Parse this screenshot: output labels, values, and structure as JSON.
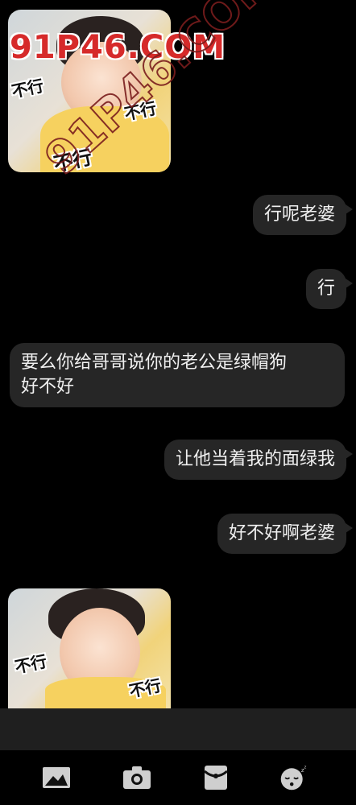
{
  "watermark": "91P46.COM",
  "messages": [
    {
      "id": "m1",
      "from": "them",
      "type": "sticker",
      "captions": [
        "不行",
        "不行",
        "不行"
      ]
    },
    {
      "id": "m2",
      "from": "me",
      "text": "行呢老婆"
    },
    {
      "id": "m3",
      "from": "me",
      "text": "行"
    },
    {
      "id": "m4",
      "from": "them",
      "text": "要么你给哥哥说你的老公是绿帽狗\n好不好"
    },
    {
      "id": "m5",
      "from": "me",
      "text": "让他当着我的面绿我"
    },
    {
      "id": "m6",
      "from": "me",
      "text": "好不好啊老婆"
    },
    {
      "id": "m7",
      "from": "them",
      "type": "sticker",
      "captions": [
        "不行",
        "不行"
      ]
    }
  ],
  "toolbar": [
    {
      "icon": "image-icon"
    },
    {
      "icon": "camera-icon"
    },
    {
      "icon": "red-packet-icon"
    },
    {
      "icon": "sleepy-emoji-icon"
    }
  ],
  "colors": {
    "background": "#000000",
    "bubble": "#262626",
    "input_bar": "#1f1f1f",
    "watermark": "#d62a2a"
  }
}
